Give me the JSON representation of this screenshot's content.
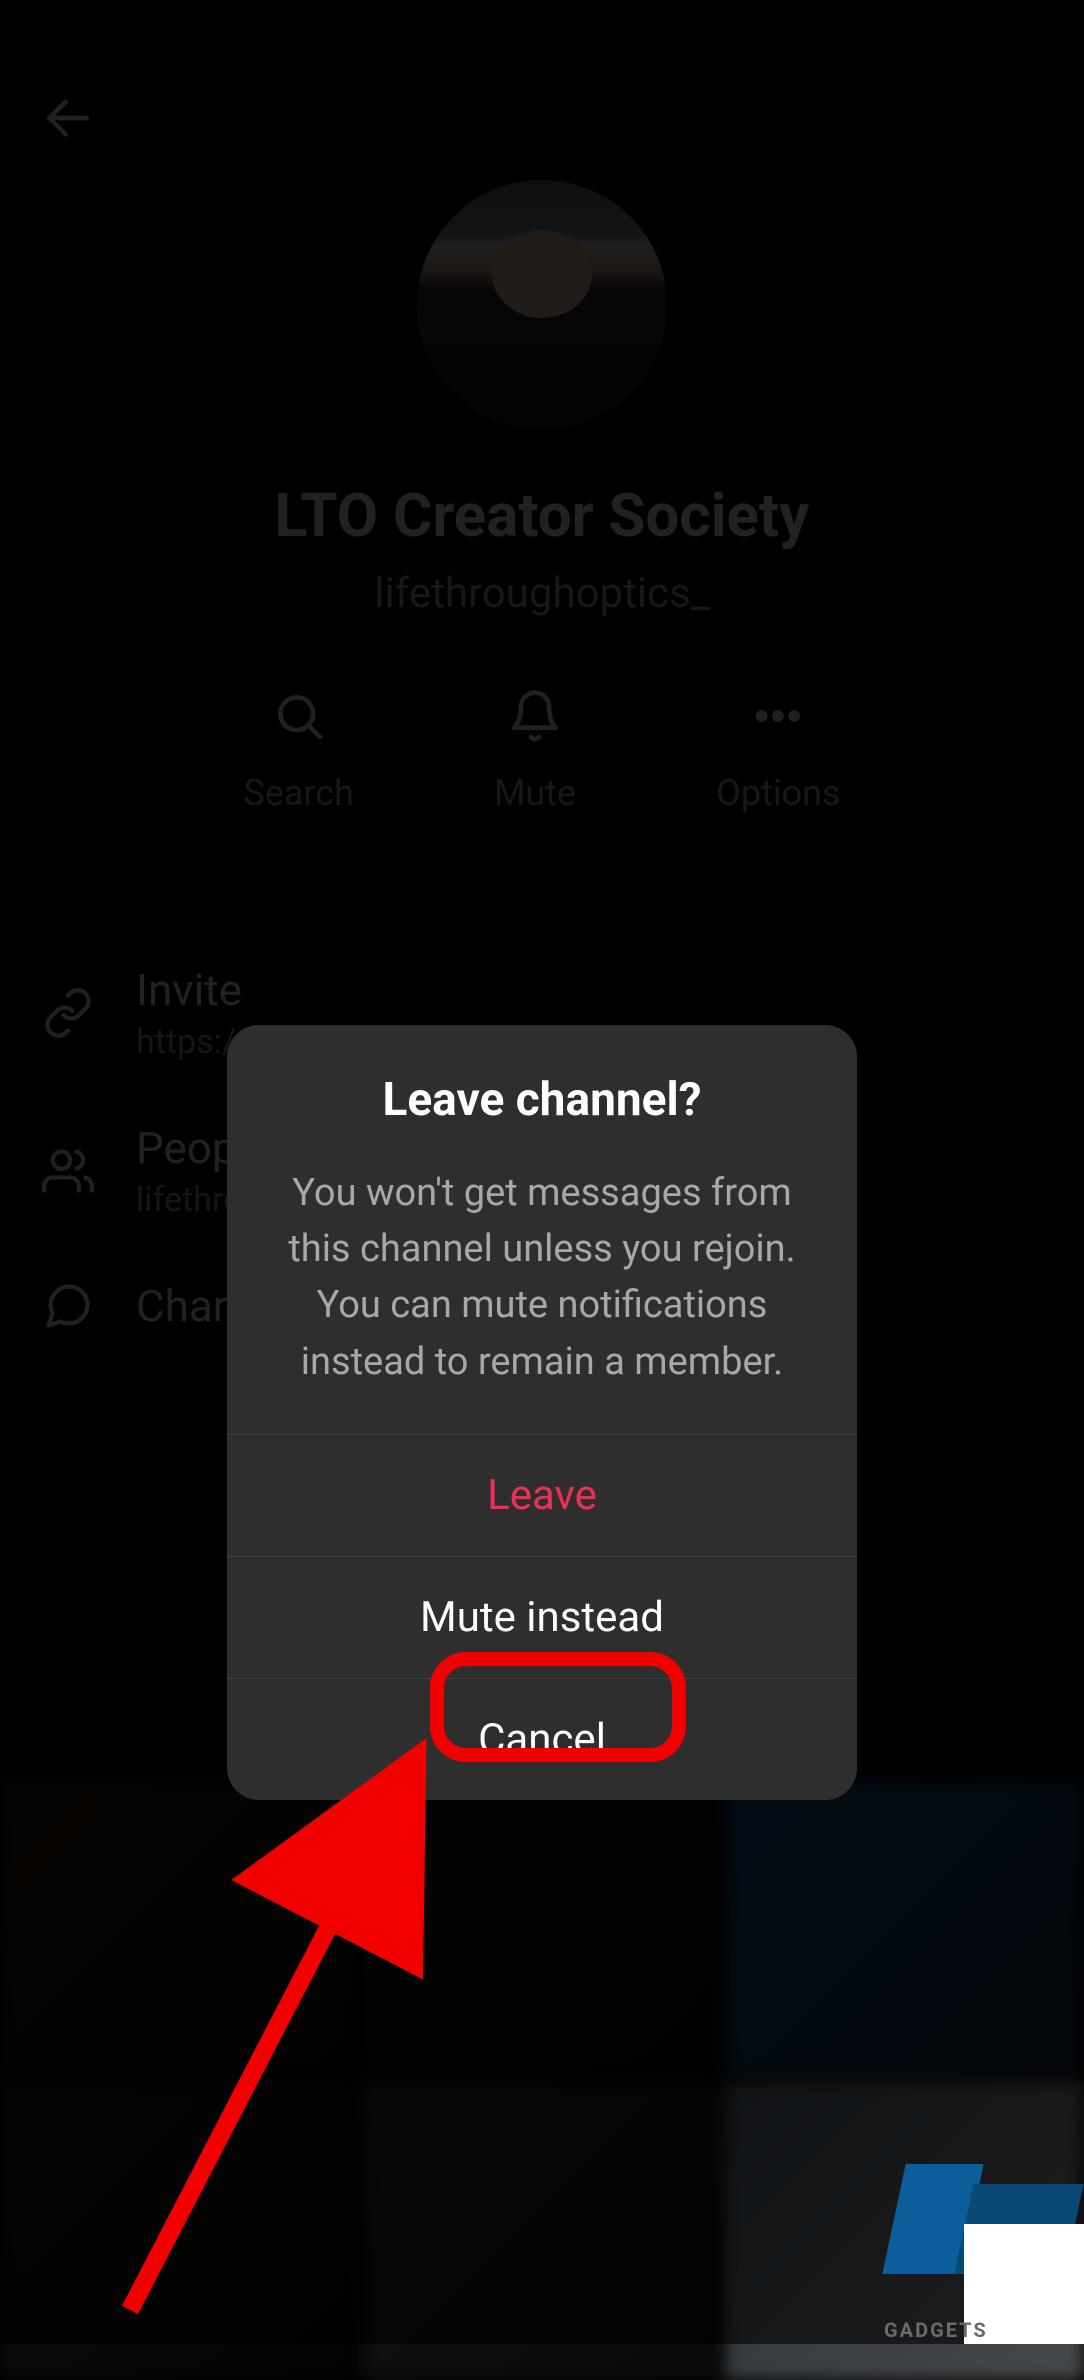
{
  "channel": {
    "title": "LTO Creator Society",
    "handle": "lifethroughoptics_"
  },
  "actions": {
    "search": "Search",
    "mute": "Mute",
    "options": "Options"
  },
  "info": {
    "invite_label": "Invite",
    "invite_url_prefix": "https://",
    "people_label": "Peop",
    "people_sub": "lifethro",
    "channel_label": "Chan"
  },
  "dialog": {
    "title": "Leave channel?",
    "body": "You won't get messages from this channel unless you rejoin. You can mute notifications instead to remain a member.",
    "leave": "Leave",
    "mute_instead": "Mute instead",
    "cancel": "Cancel"
  },
  "watermark": {
    "text": "GADGETS"
  }
}
